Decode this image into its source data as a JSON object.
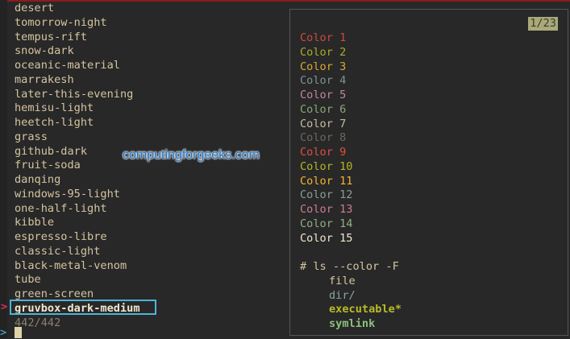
{
  "themes": [
    "desert",
    "tomorrow-night",
    "tempus-rift",
    "snow-dark",
    "oceanic-material",
    "marrakesh",
    "later-this-evening",
    "hemisu-light",
    "heetch-light",
    "grass",
    "github-dark",
    "fruit-soda",
    "danqing",
    "windows-95-light",
    "one-half-light",
    "kibble",
    "espresso-libre",
    "classic-light",
    "black-metal-venom",
    "tube",
    "green-screen"
  ],
  "selected": "gruvbox-dark-medium",
  "pointer": ">",
  "match_count": "442/442",
  "prompt": ">",
  "preview": {
    "position": "1/23",
    "colors": [
      {
        "label": "Color 1",
        "color": "#cc4a3f"
      },
      {
        "label": "Color 2",
        "color": "#a8ad2a"
      },
      {
        "label": "Color 3",
        "color": "#d9a82e"
      },
      {
        "label": "Color 4",
        "color": "#7f9294"
      },
      {
        "label": "Color 5",
        "color": "#c2859a"
      },
      {
        "label": "Color 6",
        "color": "#8aa57c"
      },
      {
        "label": "Color 7",
        "color": "#c8bca0"
      },
      {
        "label": "Color 8",
        "color": "#6e665e"
      },
      {
        "label": "Color 9",
        "color": "#e0503f"
      },
      {
        "label": "Color 10",
        "color": "#b4b524"
      },
      {
        "label": "Color 11",
        "color": "#f0b42e"
      },
      {
        "label": "Color 12",
        "color": "#8b9c9a"
      },
      {
        "label": "Color 13",
        "color": "#c97f92"
      },
      {
        "label": "Color 14",
        "color": "#8fb082"
      },
      {
        "label": "Color 15",
        "color": "#f1e7cf"
      }
    ],
    "command": "# ls --color -F",
    "files": [
      {
        "label": "file",
        "color": "#d5c4a1",
        "bold": false
      },
      {
        "label": "dir/",
        "color": "#83a5a3",
        "bold": false
      },
      {
        "label": "executable*",
        "color": "#b8bb26",
        "bold": true
      },
      {
        "label": "symlink",
        "color": "#8ec07c",
        "bold": true
      }
    ]
  },
  "watermark": "computingforgeeks.com"
}
